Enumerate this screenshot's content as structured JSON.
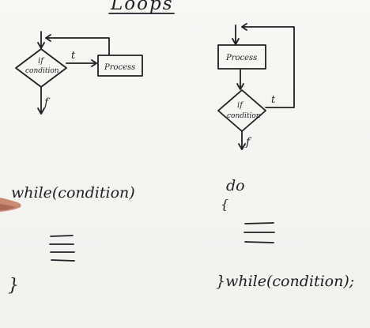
{
  "title": "Loops",
  "while_diagram": {
    "condition_label_line1": "if",
    "condition_label_line2": "condition",
    "process_label": "Process",
    "true_label": "t",
    "false_label": "f"
  },
  "do_while_diagram": {
    "process_label": "Process",
    "condition_label_line1": "if",
    "condition_label_line2": "condition",
    "true_label": "t",
    "false_label": "f"
  },
  "while_code": {
    "header": "while(condition)",
    "body_marker": "≡",
    "close_brace": "}"
  },
  "do_while_code": {
    "header": "do",
    "open_brace": "{",
    "body_marker": "≡",
    "footer": "}while(condition);"
  }
}
